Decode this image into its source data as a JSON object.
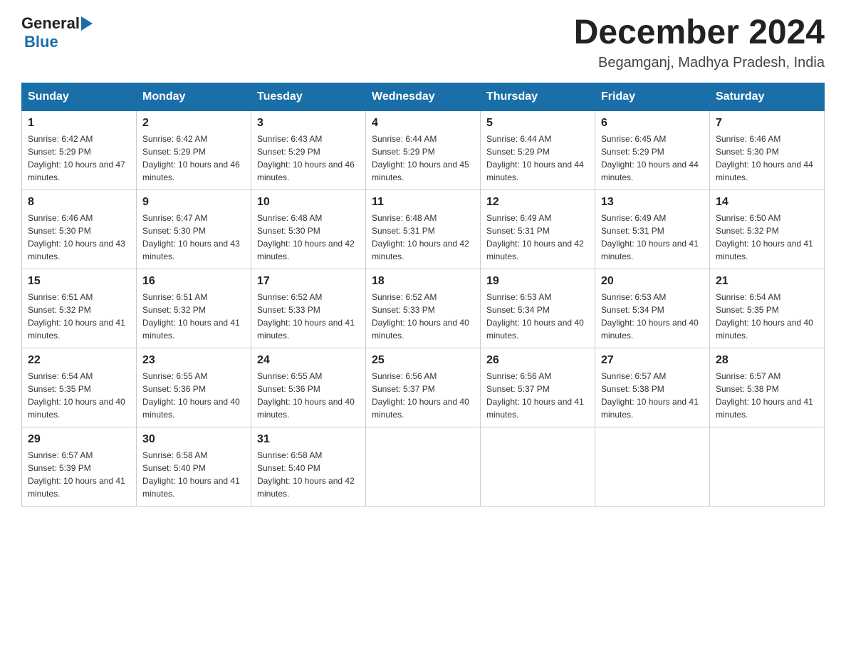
{
  "header": {
    "logo_general": "General",
    "logo_blue": "Blue",
    "month_title": "December 2024",
    "location": "Begamganj, Madhya Pradesh, India"
  },
  "weekdays": [
    "Sunday",
    "Monday",
    "Tuesday",
    "Wednesday",
    "Thursday",
    "Friday",
    "Saturday"
  ],
  "weeks": [
    [
      {
        "day": "1",
        "sunrise": "6:42 AM",
        "sunset": "5:29 PM",
        "daylight": "10 hours and 47 minutes."
      },
      {
        "day": "2",
        "sunrise": "6:42 AM",
        "sunset": "5:29 PM",
        "daylight": "10 hours and 46 minutes."
      },
      {
        "day": "3",
        "sunrise": "6:43 AM",
        "sunset": "5:29 PM",
        "daylight": "10 hours and 46 minutes."
      },
      {
        "day": "4",
        "sunrise": "6:44 AM",
        "sunset": "5:29 PM",
        "daylight": "10 hours and 45 minutes."
      },
      {
        "day": "5",
        "sunrise": "6:44 AM",
        "sunset": "5:29 PM",
        "daylight": "10 hours and 44 minutes."
      },
      {
        "day": "6",
        "sunrise": "6:45 AM",
        "sunset": "5:29 PM",
        "daylight": "10 hours and 44 minutes."
      },
      {
        "day": "7",
        "sunrise": "6:46 AM",
        "sunset": "5:30 PM",
        "daylight": "10 hours and 44 minutes."
      }
    ],
    [
      {
        "day": "8",
        "sunrise": "6:46 AM",
        "sunset": "5:30 PM",
        "daylight": "10 hours and 43 minutes."
      },
      {
        "day": "9",
        "sunrise": "6:47 AM",
        "sunset": "5:30 PM",
        "daylight": "10 hours and 43 minutes."
      },
      {
        "day": "10",
        "sunrise": "6:48 AM",
        "sunset": "5:30 PM",
        "daylight": "10 hours and 42 minutes."
      },
      {
        "day": "11",
        "sunrise": "6:48 AM",
        "sunset": "5:31 PM",
        "daylight": "10 hours and 42 minutes."
      },
      {
        "day": "12",
        "sunrise": "6:49 AM",
        "sunset": "5:31 PM",
        "daylight": "10 hours and 42 minutes."
      },
      {
        "day": "13",
        "sunrise": "6:49 AM",
        "sunset": "5:31 PM",
        "daylight": "10 hours and 41 minutes."
      },
      {
        "day": "14",
        "sunrise": "6:50 AM",
        "sunset": "5:32 PM",
        "daylight": "10 hours and 41 minutes."
      }
    ],
    [
      {
        "day": "15",
        "sunrise": "6:51 AM",
        "sunset": "5:32 PM",
        "daylight": "10 hours and 41 minutes."
      },
      {
        "day": "16",
        "sunrise": "6:51 AM",
        "sunset": "5:32 PM",
        "daylight": "10 hours and 41 minutes."
      },
      {
        "day": "17",
        "sunrise": "6:52 AM",
        "sunset": "5:33 PM",
        "daylight": "10 hours and 41 minutes."
      },
      {
        "day": "18",
        "sunrise": "6:52 AM",
        "sunset": "5:33 PM",
        "daylight": "10 hours and 40 minutes."
      },
      {
        "day": "19",
        "sunrise": "6:53 AM",
        "sunset": "5:34 PM",
        "daylight": "10 hours and 40 minutes."
      },
      {
        "day": "20",
        "sunrise": "6:53 AM",
        "sunset": "5:34 PM",
        "daylight": "10 hours and 40 minutes."
      },
      {
        "day": "21",
        "sunrise": "6:54 AM",
        "sunset": "5:35 PM",
        "daylight": "10 hours and 40 minutes."
      }
    ],
    [
      {
        "day": "22",
        "sunrise": "6:54 AM",
        "sunset": "5:35 PM",
        "daylight": "10 hours and 40 minutes."
      },
      {
        "day": "23",
        "sunrise": "6:55 AM",
        "sunset": "5:36 PM",
        "daylight": "10 hours and 40 minutes."
      },
      {
        "day": "24",
        "sunrise": "6:55 AM",
        "sunset": "5:36 PM",
        "daylight": "10 hours and 40 minutes."
      },
      {
        "day": "25",
        "sunrise": "6:56 AM",
        "sunset": "5:37 PM",
        "daylight": "10 hours and 40 minutes."
      },
      {
        "day": "26",
        "sunrise": "6:56 AM",
        "sunset": "5:37 PM",
        "daylight": "10 hours and 41 minutes."
      },
      {
        "day": "27",
        "sunrise": "6:57 AM",
        "sunset": "5:38 PM",
        "daylight": "10 hours and 41 minutes."
      },
      {
        "day": "28",
        "sunrise": "6:57 AM",
        "sunset": "5:38 PM",
        "daylight": "10 hours and 41 minutes."
      }
    ],
    [
      {
        "day": "29",
        "sunrise": "6:57 AM",
        "sunset": "5:39 PM",
        "daylight": "10 hours and 41 minutes."
      },
      {
        "day": "30",
        "sunrise": "6:58 AM",
        "sunset": "5:40 PM",
        "daylight": "10 hours and 41 minutes."
      },
      {
        "day": "31",
        "sunrise": "6:58 AM",
        "sunset": "5:40 PM",
        "daylight": "10 hours and 42 minutes."
      },
      null,
      null,
      null,
      null
    ]
  ]
}
